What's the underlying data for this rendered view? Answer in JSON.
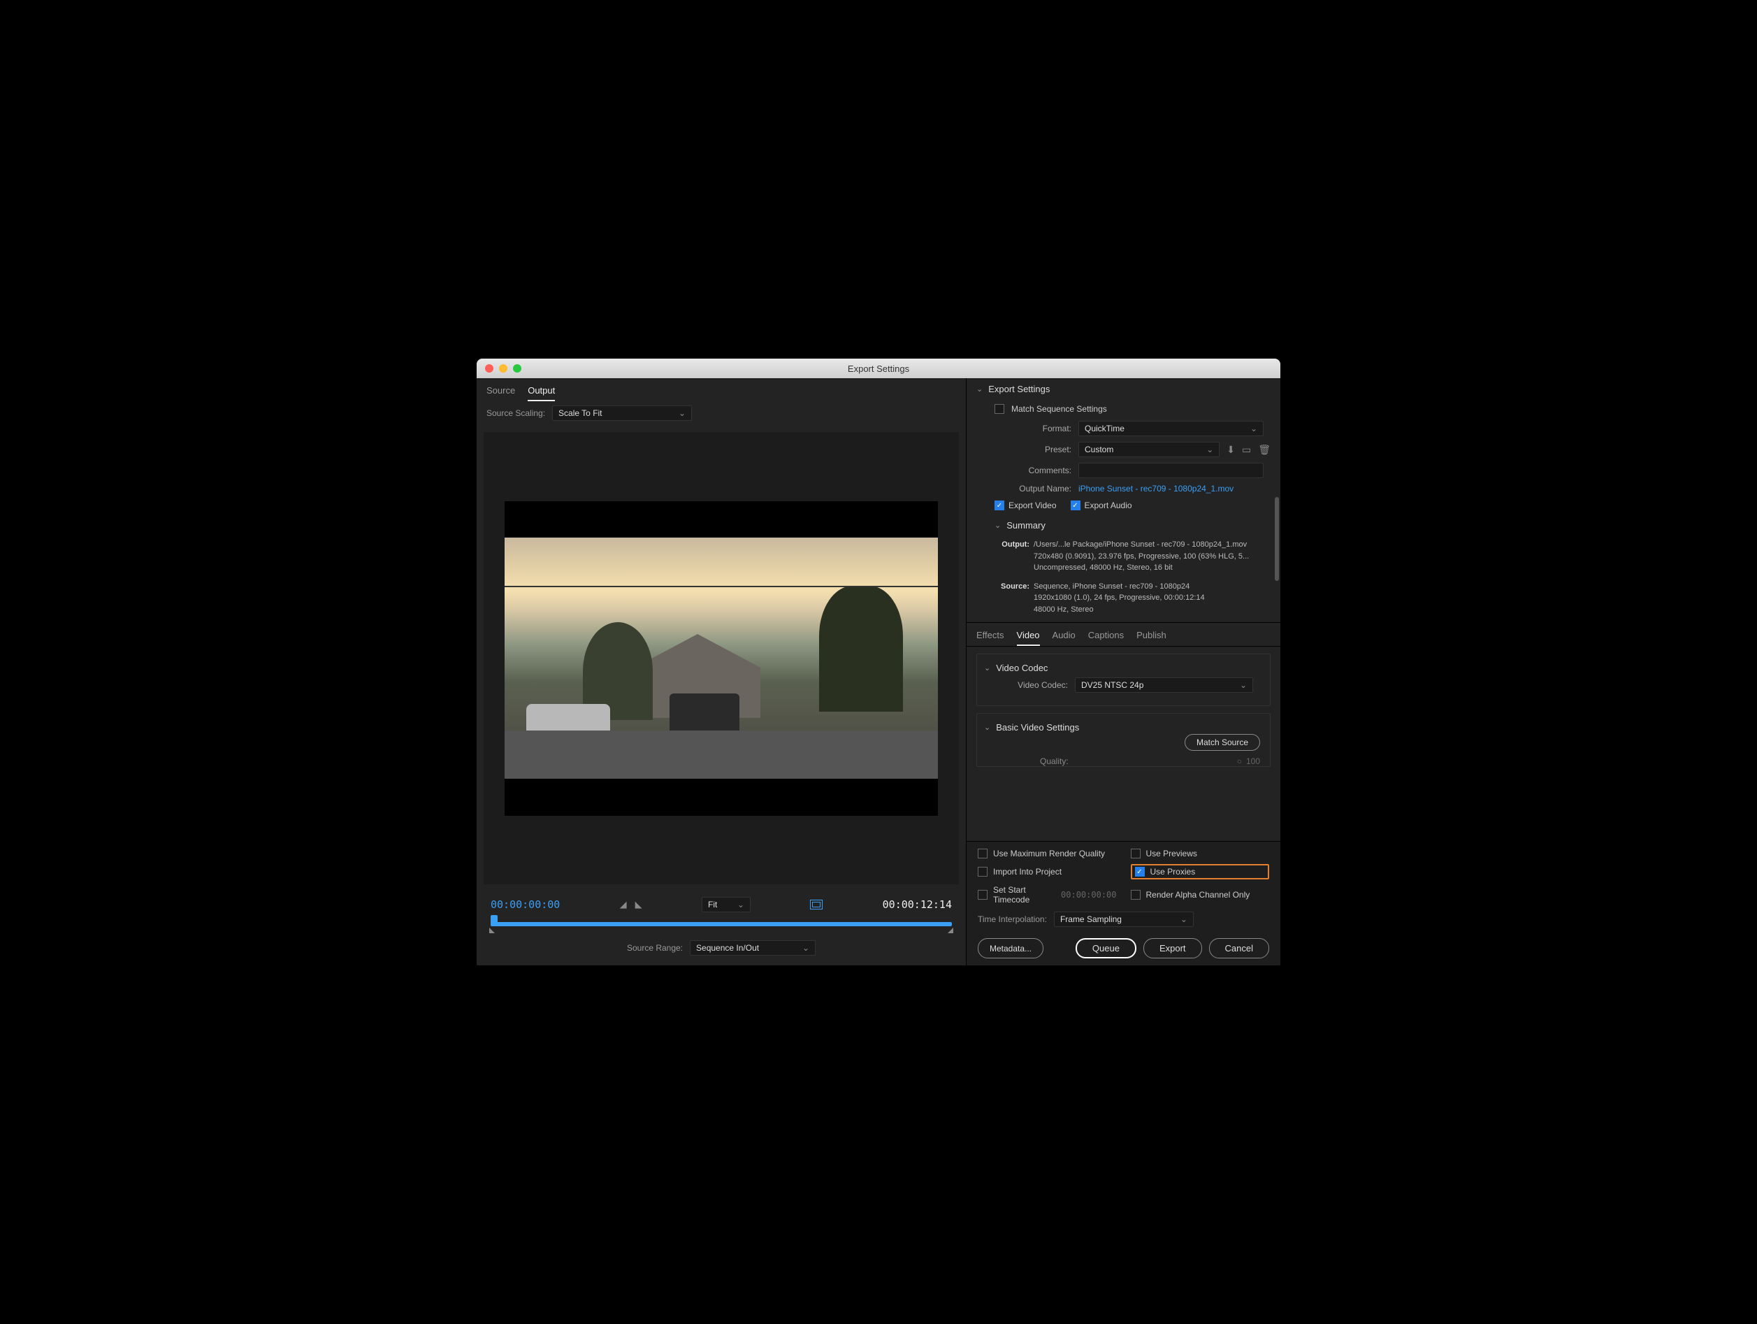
{
  "titlebar": {
    "title": "Export Settings"
  },
  "left": {
    "tabs": {
      "source": "Source",
      "output": "Output"
    },
    "sourceScaling": {
      "label": "Source Scaling:",
      "value": "Scale To Fit"
    },
    "tcIn": "00:00:00:00",
    "tcOut": "00:00:12:14",
    "fit": "Fit",
    "sourceRange": {
      "label": "Source Range:",
      "value": "Sequence In/Out"
    }
  },
  "export": {
    "header": "Export Settings",
    "matchSeq": "Match Sequence Settings",
    "format": {
      "label": "Format:",
      "value": "QuickTime"
    },
    "preset": {
      "label": "Preset:",
      "value": "Custom"
    },
    "comments": {
      "label": "Comments:"
    },
    "outputName": {
      "label": "Output Name:",
      "value": "iPhone Sunset - rec709 - 1080p24_1.mov"
    },
    "exportVideo": "Export Video",
    "exportAudio": "Export Audio",
    "summaryHead": "Summary",
    "summaryOutLabel": "Output:",
    "summaryOut1": "/Users/...le Package/iPhone Sunset - rec709 - 1080p24_1.mov",
    "summaryOut2": "720x480 (0.9091), 23.976 fps, Progressive, 100 (63% HLG, 5...",
    "summaryOut3": "Uncompressed, 48000 Hz, Stereo, 16 bit",
    "summarySrcLabel": "Source:",
    "summarySrc1": "Sequence, iPhone Sunset - rec709 - 1080p24",
    "summarySrc2": "1920x1080 (1.0), 24 fps, Progressive, 00:00:12:14",
    "summarySrc3": "48000 Hz, Stereo"
  },
  "videoTabs": {
    "effects": "Effects",
    "video": "Video",
    "audio": "Audio",
    "captions": "Captions",
    "publish": "Publish"
  },
  "codec": {
    "head": "Video Codec",
    "label": "Video Codec:",
    "value": "DV25 NTSC 24p",
    "basicHead": "Basic Video Settings",
    "matchSource": "Match Source",
    "quality": "Quality:",
    "qualityVal": "100"
  },
  "opts": {
    "maxRender": "Use Maximum Render Quality",
    "previews": "Use Previews",
    "import": "Import Into Project",
    "proxies": "Use Proxies",
    "startTc": "Set Start Timecode",
    "startTcVal": "00:00:00:00",
    "alpha": "Render Alpha Channel Only",
    "timeInterp": {
      "label": "Time Interpolation:",
      "value": "Frame Sampling"
    }
  },
  "buttons": {
    "metadata": "Metadata...",
    "queue": "Queue",
    "export": "Export",
    "cancel": "Cancel"
  }
}
